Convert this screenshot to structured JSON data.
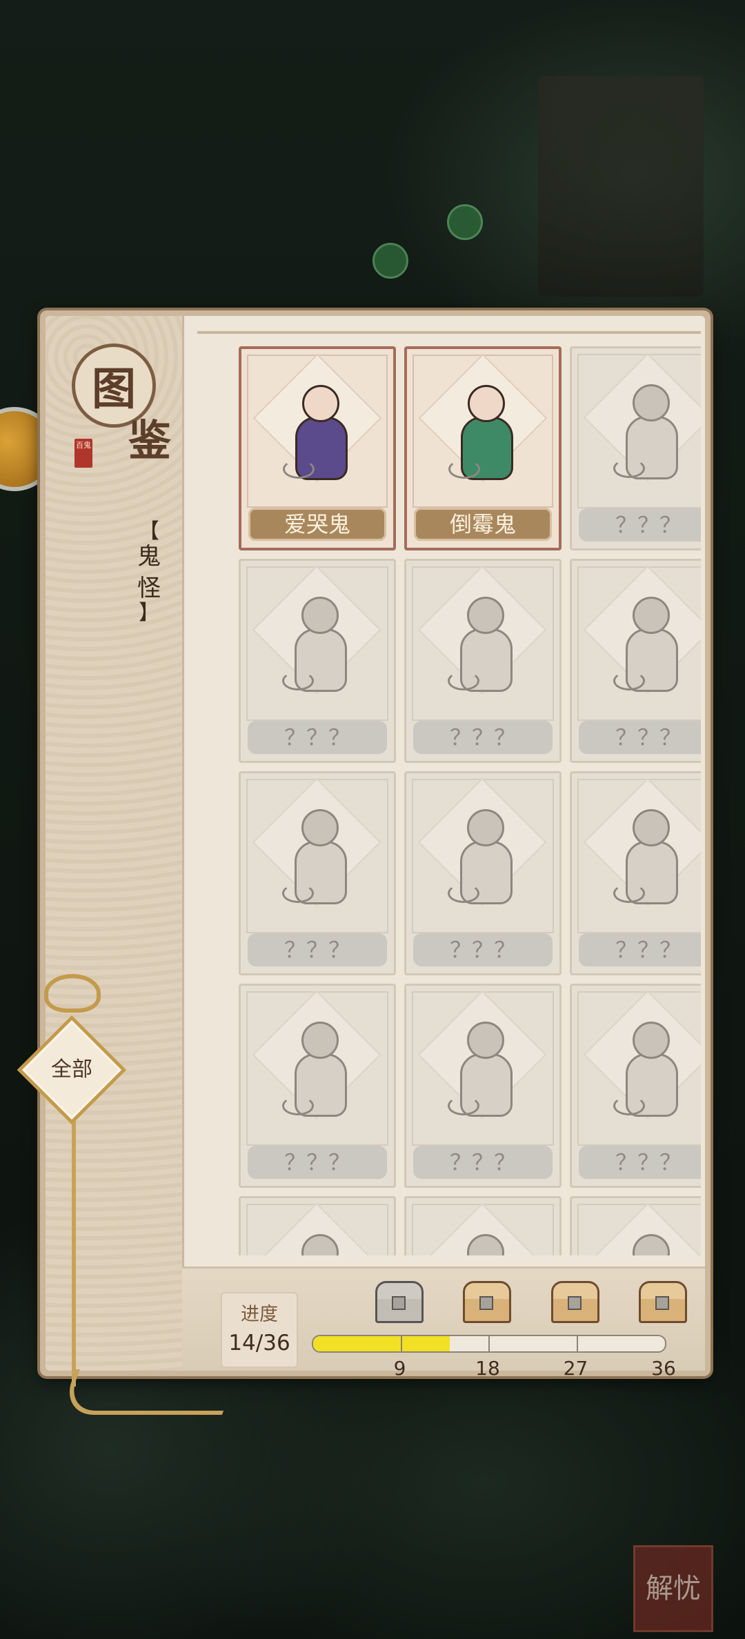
{
  "book": {
    "title_char1": "图",
    "title_char2": "鉴",
    "seal_text": "百鬼",
    "category_label": "鬼怪",
    "bracket_open": "【",
    "bracket_close": "】"
  },
  "filter": {
    "label": "全部"
  },
  "cards": [
    {
      "name": "爱哭鬼",
      "unlocked": true
    },
    {
      "name": "倒霉鬼",
      "unlocked": true
    },
    {
      "name": "？？？",
      "unlocked": false
    },
    {
      "name": "？？？",
      "unlocked": false
    },
    {
      "name": "？？？",
      "unlocked": false
    },
    {
      "name": "？？？",
      "unlocked": false
    },
    {
      "name": "？？？",
      "unlocked": false
    },
    {
      "name": "？？？",
      "unlocked": false
    },
    {
      "name": "？？？",
      "unlocked": false
    },
    {
      "name": "？？？",
      "unlocked": false
    },
    {
      "name": "？？？",
      "unlocked": false
    },
    {
      "name": "？？？",
      "unlocked": false
    },
    {
      "name": "",
      "unlocked": false
    },
    {
      "name": "",
      "unlocked": false
    },
    {
      "name": "",
      "unlocked": false
    }
  ],
  "progress": {
    "label": "进度",
    "count": "14/36",
    "current": 14,
    "total": 36,
    "milestones": [
      "9",
      "18",
      "27",
      "36"
    ]
  },
  "background": {
    "stamp_text": "解忧"
  },
  "colors": {
    "progress_fill": "#f1e023",
    "unlocked_border": "#a66b5a",
    "name_plate_unlocked": "#a9875d"
  }
}
